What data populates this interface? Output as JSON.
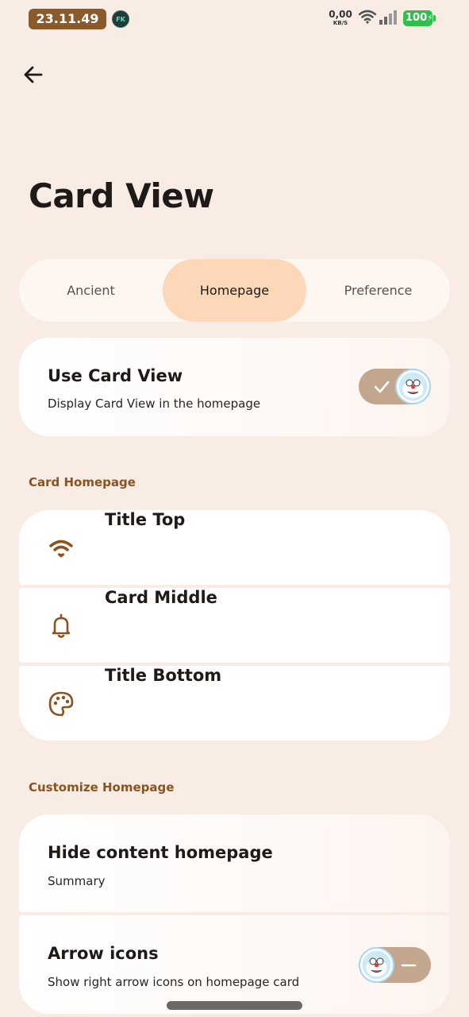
{
  "status_bar": {
    "time": "23.11.49",
    "app_badge": "FK",
    "net_speed_value": "0,00",
    "net_speed_unit": "KB/S",
    "battery": "100"
  },
  "header": {
    "back_icon": "arrow-left-icon",
    "title": "Card View"
  },
  "tabs": [
    {
      "label": "Ancient",
      "active": false
    },
    {
      "label": "Homepage",
      "active": true
    },
    {
      "label": "Preference",
      "active": false
    }
  ],
  "use_card_view": {
    "title": "Use Card View",
    "subtitle": "Display Card View in the homepage",
    "enabled": true
  },
  "card_homepage": {
    "header": "Card Homepage",
    "items": [
      {
        "label": "Title Top",
        "icon": "wifi-icon"
      },
      {
        "label": "Card Middle",
        "icon": "bell-icon"
      },
      {
        "label": "Title Bottom",
        "icon": "palette-icon"
      }
    ]
  },
  "customize_homepage": {
    "header": "Customize Homepage",
    "hide_content": {
      "title": "Hide content homepage",
      "subtitle": "Summary"
    },
    "arrow_icons": {
      "title": "Arrow icons",
      "subtitle": "Show right arrow icons on homepage card",
      "enabled": false
    }
  },
  "colors": {
    "background": "#f8ece4",
    "accent": "#8a5320",
    "tab_active": "#fcd8b9",
    "toggle_track": "#c3a68e"
  }
}
